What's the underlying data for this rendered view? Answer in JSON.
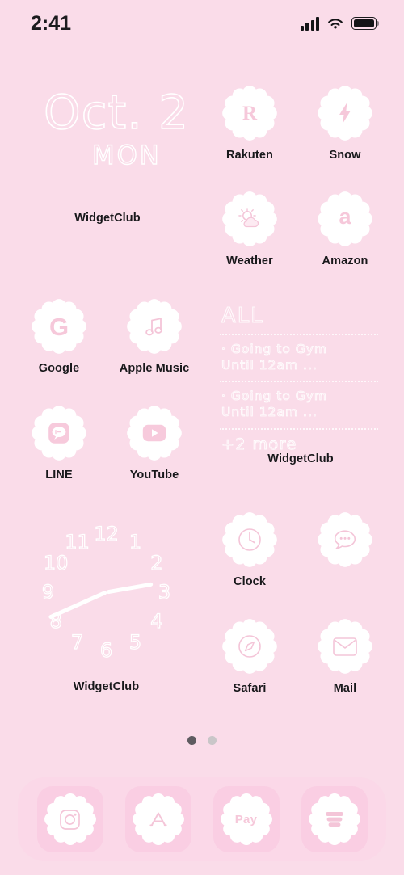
{
  "theme": {
    "background": "#fadce9",
    "icon_fill": "#ffffff",
    "glyph_color": "#f6c8da",
    "label_color": "#18181b",
    "dock_bg": "#fcd6e7",
    "dock_tile": "#fac6de"
  },
  "status_bar": {
    "time": "2:41",
    "cellular": "signal-bars-icon",
    "wifi": "wifi-icon",
    "battery": "battery-full-icon"
  },
  "date_widget": {
    "date": "Oct. 2",
    "day_of_week": "MON",
    "label": "WidgetClub"
  },
  "reminders_widget": {
    "title": "ALL",
    "items": [
      "· Going to Gym\nUntil 12am ...",
      "· Going to Gym\nUntil 12am ..."
    ],
    "more": "+2 more",
    "label": "WidgetClub"
  },
  "clock_widget": {
    "numbers": [
      "1",
      "2",
      "3",
      "4",
      "5",
      "6",
      "7",
      "8",
      "9",
      "10",
      "11",
      "12"
    ],
    "label": "WidgetClub",
    "hour_angle": 80,
    "minute_angle": 246
  },
  "apps": [
    {
      "label": "Rakuten",
      "icon": "rakuten-icon",
      "glyph": "R"
    },
    {
      "label": "Snow",
      "icon": "snow-icon",
      "glyph": "bolt"
    },
    {
      "label": "Weather",
      "icon": "weather-icon",
      "glyph": "sun-cloud"
    },
    {
      "label": "Amazon",
      "icon": "amazon-icon",
      "glyph": "a"
    },
    {
      "label": "Google",
      "icon": "google-icon",
      "glyph": "G"
    },
    {
      "label": "Apple Music",
      "icon": "apple-music-icon",
      "glyph": "music-note"
    },
    {
      "label": "LINE",
      "icon": "line-icon",
      "glyph": "speech-bubble"
    },
    {
      "label": "YouTube",
      "icon": "youtube-icon",
      "glyph": "play"
    },
    {
      "label": "Clock",
      "icon": "clock-icon",
      "glyph": "clock-face"
    },
    {
      "label": "",
      "icon": "messages-icon",
      "glyph": "chat-dots"
    },
    {
      "label": "Safari",
      "icon": "safari-icon",
      "glyph": "compass"
    },
    {
      "label": "Mail",
      "icon": "mail-icon",
      "glyph": "envelope"
    }
  ],
  "page_dots": {
    "count": 2,
    "active_index": 0
  },
  "dock": [
    {
      "icon": "instagram-icon",
      "glyph": "camera"
    },
    {
      "icon": "app-store-icon",
      "glyph": "A"
    },
    {
      "icon": "apple-pay-icon",
      "glyph": "Pay"
    },
    {
      "icon": "wallet-icon",
      "glyph": "stack"
    }
  ]
}
